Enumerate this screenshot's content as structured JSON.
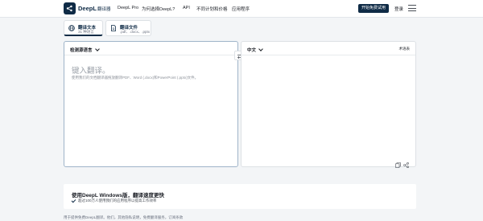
{
  "header": {
    "brand": "DeepL",
    "brand_sub": "翻译器",
    "nav": [
      "DeepL Pro",
      "为何选择DeepL?",
      "API",
      "不同计划和价格",
      "应用程序"
    ],
    "cta": "开始免费试用",
    "login": "登录",
    "icons": {
      "logo": "deepl-logo-icon",
      "menu": "hamburger-menu-icon"
    }
  },
  "tabs": [
    {
      "title": "翻译文本",
      "subtitle": "31 种语言",
      "icon": "globe-icon"
    },
    {
      "title": "翻译文件",
      "subtitle": ".pdf、.docx、.pptx",
      "icon": "file-icon"
    }
  ],
  "source": {
    "language": "检测源语言",
    "placeholder": "键入翻译。",
    "hint": "使用我们的文档翻译器拖放翻译PDF、Word (.docx)和PowerPoint (.pptx)文件。"
  },
  "target": {
    "language": "中文",
    "glossary": "术语表"
  },
  "promo": {
    "title": "使用DeepL Windows版，翻译速度更快",
    "desc": "超过100万人使用我们的应用程序以提高工作效率"
  },
  "footer": "用于提供免费DeepL翻译。他们，其他隐私说明，免费翻译服务，订阅条款"
}
